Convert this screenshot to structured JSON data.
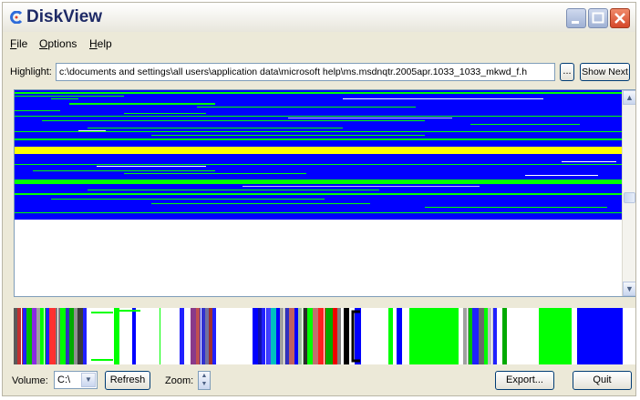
{
  "app": {
    "title": "DiskView",
    "icon": "diskview-app-icon"
  },
  "window_controls": {
    "minimize": "minimize-icon",
    "maximize": "maximize-icon",
    "close": "close-icon"
  },
  "menu": {
    "items": [
      "File",
      "Options",
      "Help"
    ]
  },
  "highlight": {
    "label": "Highlight:",
    "value": "c:\\documents and settings\\all users\\application data\\microsoft help\\ms.msdnqtr.2005apr.1033_1033_mkwd_f.h",
    "browse_label": "...",
    "show_next_label": "Show Next"
  },
  "colors": {
    "blue": "#0000ff",
    "green": "#00ff00",
    "yellow": "#ffff00",
    "white": "#ffffff",
    "gray": "#808080"
  },
  "cluster_map": {
    "icon": "disk-cluster-map"
  },
  "scrollbar": {
    "up_icon": "scroll-up-icon",
    "down_icon": "scroll-down-icon"
  },
  "volume": {
    "label": "Volume:",
    "value": "C:\\"
  },
  "refresh_label": "Refresh",
  "zoom_label": "Zoom:",
  "export_label": "Export...",
  "quit_label": "Quit"
}
